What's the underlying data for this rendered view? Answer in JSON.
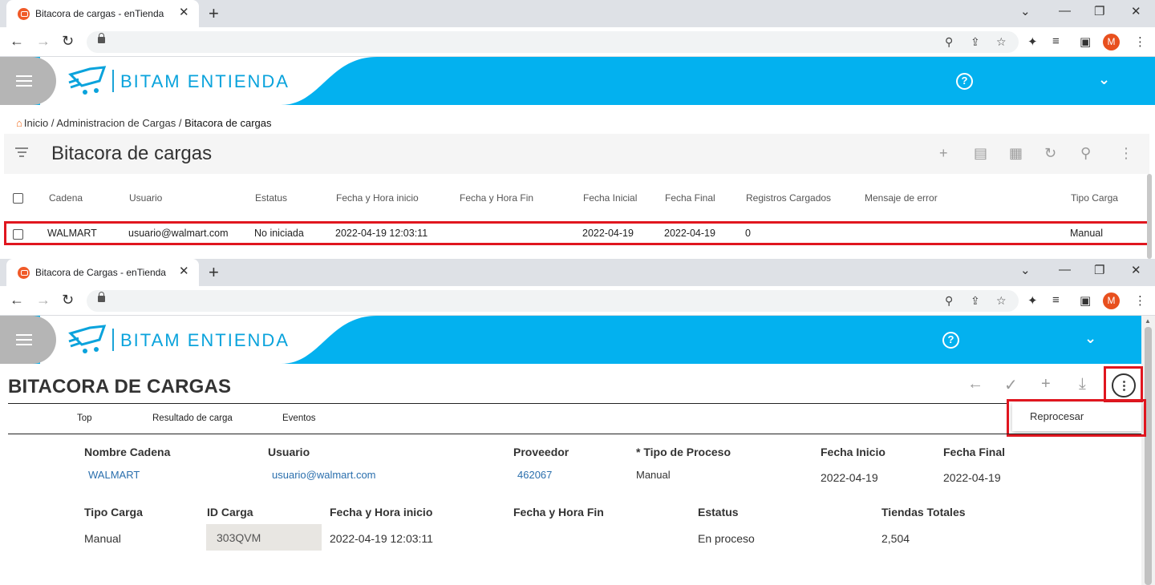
{
  "window1": {
    "tab_title": "Bitacora de cargas - enTienda",
    "breadcrumb": {
      "home": "Inicio",
      "sep1": "/",
      "section": "Administracion de Cargas",
      "sep2": "/",
      "current": "Bitacora de cargas"
    },
    "list_title": "Bitacora de cargas",
    "columns": [
      "Cadena",
      "Usuario",
      "Estatus",
      "Fecha y Hora inicio",
      "Fecha y Hora Fin",
      "Fecha Inicial",
      "Fecha Final",
      "Registros Cargados",
      "Mensaje de error",
      "Tipo Carga"
    ],
    "rows": [
      {
        "cadena": "WALMART",
        "usuario": "usuario@walmart.com",
        "estatus": "No iniciada",
        "inicio": "2022-04-19 12:03:11",
        "fin": "",
        "fecha_inicial": "2022-04-19",
        "fecha_final": "2022-04-19",
        "registros": "0",
        "mensaje": "",
        "tipo": "Manual"
      }
    ]
  },
  "window2": {
    "tab_title": "Bitacora de Cargas - enTienda",
    "record_title": "BITACORA DE CARGAS",
    "menu": {
      "reprocesar": "Reprocesar"
    },
    "subtabs": [
      "Top",
      "Resultado de carga",
      "Eventos"
    ],
    "fields": {
      "nombre_cadena": {
        "label": "Nombre Cadena",
        "value": "WALMART"
      },
      "usuario": {
        "label": "Usuario",
        "value": "usuario@walmart.com"
      },
      "proveedor": {
        "label": "Proveedor",
        "value": "462067"
      },
      "tipo_proceso": {
        "label": "* Tipo de Proceso",
        "value": "Manual"
      },
      "fecha_inicio": {
        "label": "Fecha Inicio",
        "value": "2022-04-19"
      },
      "fecha_final": {
        "label": "Fecha Final",
        "value": "2022-04-19"
      },
      "tipo_carga": {
        "label": "Tipo Carga",
        "value": "Manual"
      },
      "id_carga": {
        "label": "ID Carga",
        "value": "303QVM"
      },
      "fecha_hora_inicio": {
        "label": "Fecha y Hora inicio",
        "value": "2022-04-19 12:03:11"
      },
      "fecha_hora_fin": {
        "label": "Fecha y Hora Fin",
        "value": ""
      },
      "estatus": {
        "label": "Estatus",
        "value": "En proceso"
      },
      "tiendas_totales": {
        "label": "Tiendas Totales",
        "value": "2,504"
      }
    }
  },
  "app": {
    "logo_text": "BITAM ENTIENDA",
    "avatar_letter": "M",
    "help_glyph": "?"
  },
  "colors": {
    "brand_blue": "#03b1ef",
    "highlight_red": "#e0161f",
    "accent_orange": "#f26b1d"
  }
}
